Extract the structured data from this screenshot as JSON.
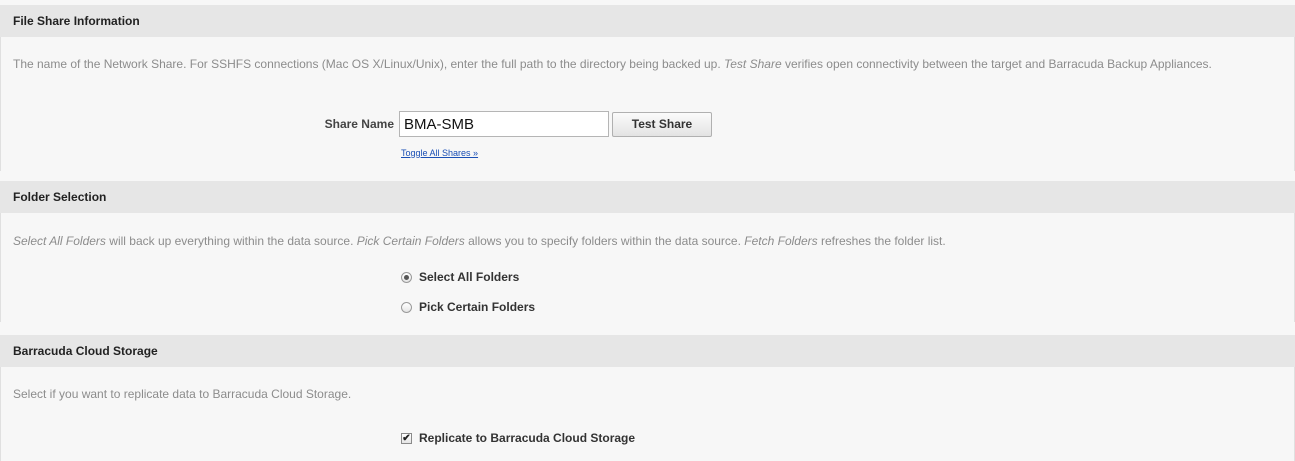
{
  "file_share": {
    "header": "File Share Information",
    "desc_part1": "The name of the Network Share. For SSHFS connections (Mac OS X/Linux/Unix), enter the full path to the directory being backed up. ",
    "desc_em": "Test Share",
    "desc_part2": " verifies open connectivity between the target and Barracuda Backup Appliances.",
    "share_name_label": "Share Name",
    "share_name_value": "BMA-SMB",
    "test_share_button": "Test Share",
    "toggle_link": "Toggle All Shares »"
  },
  "folder_selection": {
    "header": "Folder Selection",
    "desc_em1": "Select All Folders",
    "desc_part1": " will back up everything within the data source. ",
    "desc_em2": "Pick Certain Folders",
    "desc_part2": " allows you to specify folders within the data source. ",
    "desc_em3": "Fetch Folders",
    "desc_part3": " refreshes the folder list.",
    "option_all": "Select All Folders",
    "option_pick": "Pick Certain Folders",
    "selected": "Select All Folders"
  },
  "cloud_storage": {
    "header": "Barracuda Cloud Storage",
    "desc": "Select if you want to replicate data to Barracuda Cloud Storage.",
    "replicate_label": "Replicate to Barracuda Cloud Storage",
    "replicate_checked": true
  }
}
